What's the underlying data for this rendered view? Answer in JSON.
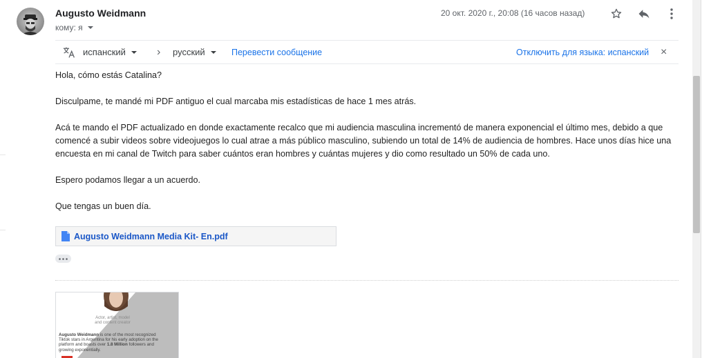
{
  "email": {
    "sender": "Augusto Weidmann",
    "recipient_label": "кому: я",
    "date": "20 окт. 2020 г., 20:08 (16 часов назад)"
  },
  "icons": {
    "star": "star-icon",
    "reply": "reply-icon",
    "more": "more-vert-icon",
    "translate": "translate-icon",
    "close": "close-icon",
    "attachment": "file-icon"
  },
  "translate_bar": {
    "source_lang": "испанский",
    "arrow": "›",
    "target_lang": "русский",
    "translate_link": "Перевести сообщение",
    "disable_link": "Отключить для языка: испанский",
    "close": "×"
  },
  "body": {
    "p1": "Hola, cómo estás Catalina?",
    "p2": "Disculpame, te mandé mi PDF antiguo el cual marcaba mis estadísticas de hace 1 mes atrás.",
    "p3": "Acá te mando el PDF actualizado en donde exactamente recalco que mi audiencia masculina incrementó de manera exponencial el último mes, debido a que comencé a subir videos sobre videojuegos lo cual atrae a más público masculino, subiendo un total de 14% de audiencia de hombres. Hace unos días hice una encuesta en mi canal de Twitch para saber cuántos eran hombres y cuántas mujeres y dio como resultado un 50% de cada uno.",
    "p4": "Espero podamos llegar a un acuerdo.",
    "p5": "Que tengas un buen día."
  },
  "attachment": {
    "name": "Augusto Weidmann Media Kit- En.pdf"
  },
  "thumbnail": {
    "caption": "Actor, artist, model and content creator",
    "text_name": "Augusto Weidmann",
    "text_1": " is one of the most recognized Tiktok stars in Argentina for his early adoption on the platform and boasts over ",
    "text_bold": "1.8 Million",
    "text_2": " followers and growing exponentially."
  },
  "colors": {
    "link": "#1a73e8",
    "attachment_link": "#1a57c7",
    "muted": "#5f6368",
    "thumbnail_red": "#d93025"
  }
}
